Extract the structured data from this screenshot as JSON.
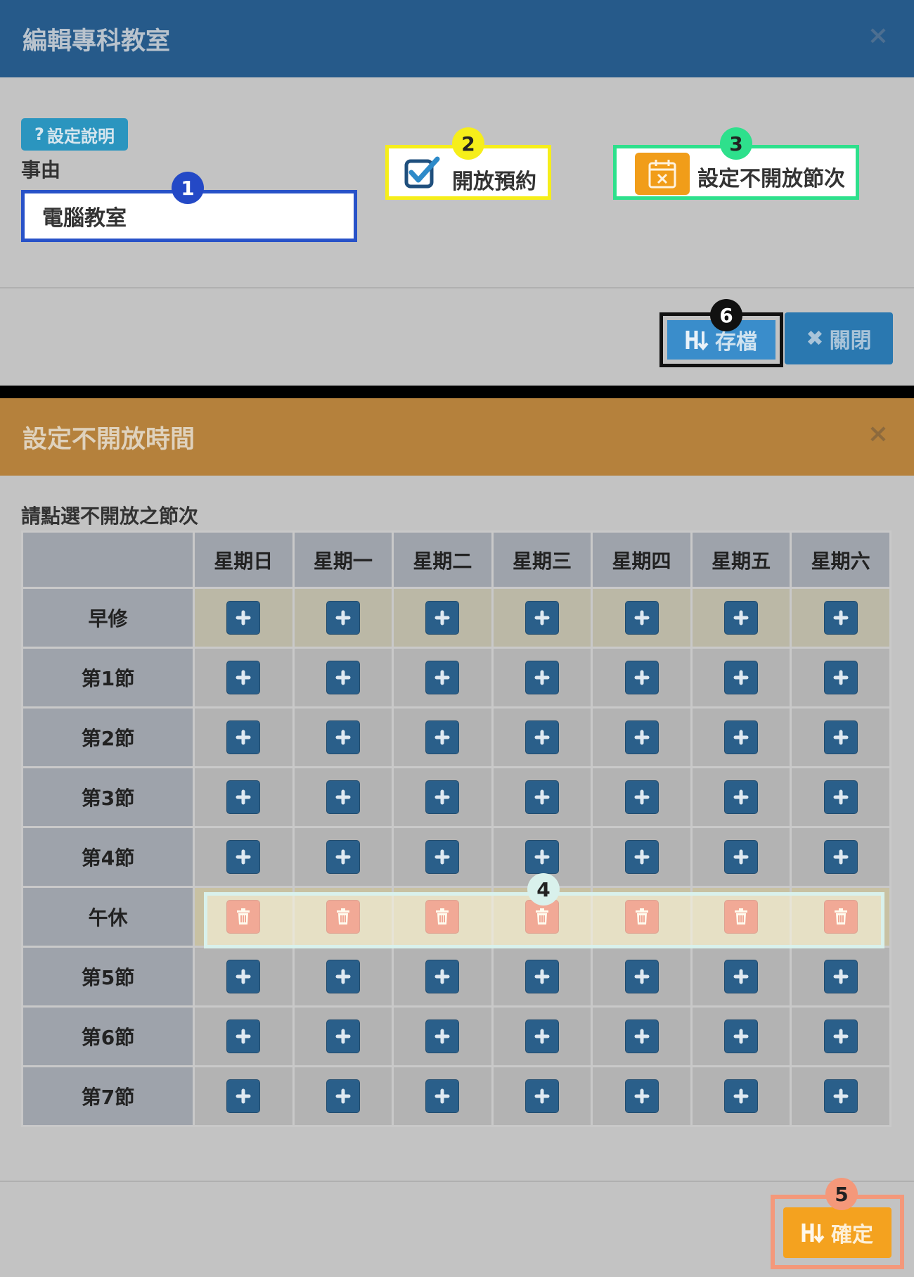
{
  "modal1": {
    "title": "編輯專科教室",
    "close_icon": "×",
    "help_button": "設定說明",
    "help_icon_glyph": "?",
    "reason_label": "事由",
    "reason_value": "電腦教室",
    "open_booking_label": "開放預約",
    "set_closed_label": "設定不開放節次",
    "save_label": "存檔",
    "close_label": "關閉",
    "close_glyph": "✖"
  },
  "modal2": {
    "title": "設定不開放時間",
    "close_icon": "×",
    "instruction": "請點選不開放之節次",
    "days": [
      "星期日",
      "星期一",
      "星期二",
      "星期三",
      "星期四",
      "星期五",
      "星期六"
    ],
    "periods": [
      {
        "label": "早修",
        "state": "open"
      },
      {
        "label": "第1節",
        "state": "open"
      },
      {
        "label": "第2節",
        "state": "open"
      },
      {
        "label": "第3節",
        "state": "open"
      },
      {
        "label": "第4節",
        "state": "open"
      },
      {
        "label": "午休",
        "state": "closed"
      },
      {
        "label": "第5節",
        "state": "open"
      },
      {
        "label": "第6節",
        "state": "open"
      },
      {
        "label": "第7節",
        "state": "open"
      }
    ],
    "confirm_label": "確定"
  },
  "badges": [
    "1",
    "2",
    "3",
    "4",
    "5",
    "6"
  ],
  "colors": {
    "modal1_header": "#265a8a",
    "modal2_header": "#b5813c",
    "plus_button": "#2a5f8a",
    "trash_button": "#e0473b",
    "confirm_button": "#f4a21f",
    "save_button": "#3a8dcb"
  },
  "icons": {
    "checkbox": "checkbox-checked-icon",
    "calendar": "calendar-x-icon",
    "save": "save-sort-icon",
    "plus": "plus-icon",
    "trash": "trash-icon"
  }
}
